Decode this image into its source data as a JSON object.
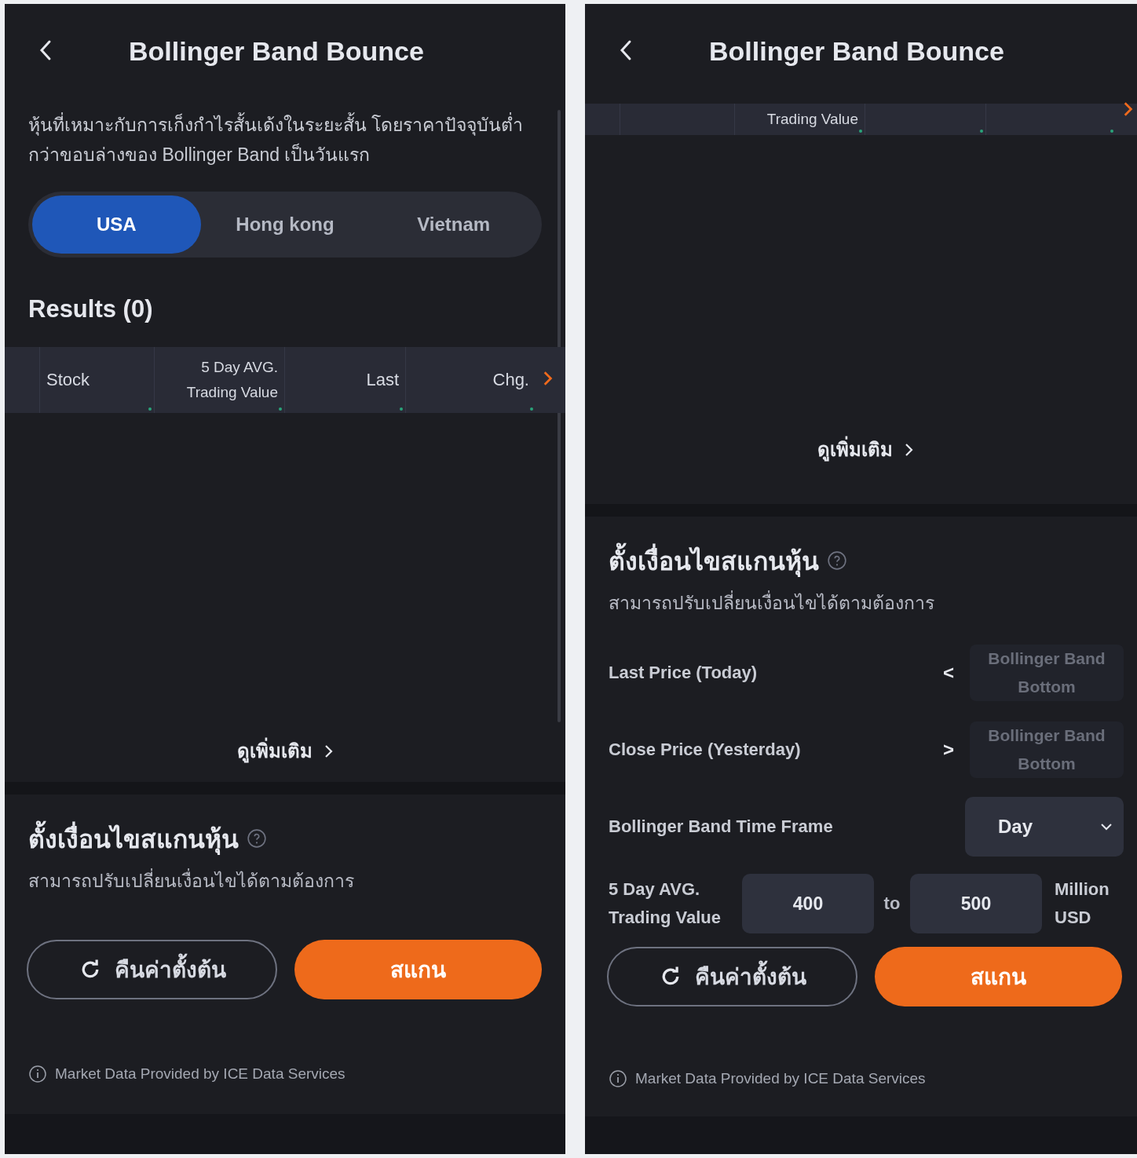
{
  "screens": [
    {
      "title": "Bollinger Band Bounce",
      "description": "หุ้นที่เหมาะกับการเก็งกำไรสั้นเด้งในระยะสั้น โดยราคาปัจจุบันต่ำกว่าขอบล่างของ Bollinger Band เป็นวันแรก",
      "tabs": [
        {
          "label": "USA",
          "selected": true
        },
        {
          "label": "Hong kong",
          "selected": false
        },
        {
          "label": "Vietnam",
          "selected": false
        }
      ],
      "results_label": "Results (0)",
      "columns": [
        "Stock",
        "5 Day AVG. Trading Value",
        "Last",
        "Chg."
      ],
      "see_more": "ดูเพิ่มเติม",
      "conditions": {
        "title": "ตั้งเงื่อนไขสแกนหุ้น",
        "subtitle": "สามารถปรับเปลี่ยนเงื่อนไขได้ตามต้องการ"
      },
      "reset_button": "คืนค่าตั้งต้น",
      "scan_button": "สแกน",
      "footnote": "Market Data Provided by ICE Data Services"
    },
    {
      "title": "Bollinger Band Bounce",
      "columns": [
        null,
        "Trading Value",
        null,
        null
      ],
      "see_more": "ดูเพิ่มเติม",
      "conditions": {
        "title": "ตั้งเงื่อนไขสแกนหุ้น",
        "subtitle": "สามารถปรับเปลี่ยนเงื่อนไขได้ตามต้องการ",
        "rows": [
          {
            "kind": "compare",
            "label": "Last Price (Today)",
            "operator": "<",
            "placeholder": "Bollinger Band Bottom"
          },
          {
            "kind": "compare",
            "label": "Close Price (Yesterday)",
            "operator": ">",
            "placeholder": "Bollinger Band Bottom"
          },
          {
            "kind": "select",
            "label": "Bollinger Band Time Frame",
            "value": "Day"
          },
          {
            "kind": "range",
            "label": "5 Day AVG. Trading Value",
            "from": "400",
            "joiner": "to",
            "to": "500",
            "unit": "Million USD"
          }
        ]
      },
      "reset_button": "คืนค่าตั้งต้น",
      "scan_button": "สแกน",
      "footnote": "Market Data Provided by ICE Data Services"
    }
  ]
}
